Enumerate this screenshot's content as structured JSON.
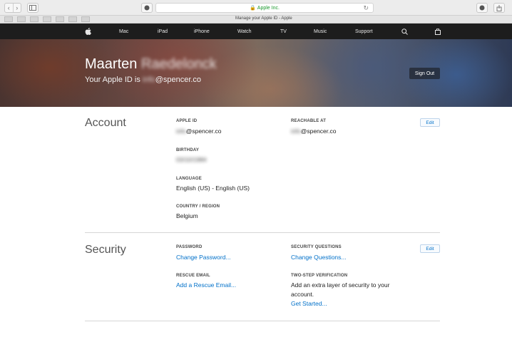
{
  "browser": {
    "url": "Apple Inc.",
    "tab_title": "Manage your Apple ID - Apple",
    "nav_back": "‹",
    "nav_forward": "›"
  },
  "global_nav": {
    "items": [
      "Mac",
      "iPad",
      "iPhone",
      "Watch",
      "TV",
      "Music",
      "Support"
    ]
  },
  "hero": {
    "first_name": "Maarten",
    "last_name": "Raedelonck",
    "apple_id_prefix": "Your Apple ID is",
    "apple_id_user": "info",
    "apple_id_domain": "@spencer.co",
    "sign_out": "Sign Out"
  },
  "account": {
    "title": "Account",
    "edit": "Edit",
    "apple_id_label": "APPLE ID",
    "apple_id_user": "info",
    "apple_id_domain": "@spencer.co",
    "reachable_label": "REACHABLE AT",
    "reachable_user": "info",
    "reachable_domain": "@spencer.co",
    "birthday_label": "BIRTHDAY",
    "birthday_value": "03/10/1984",
    "language_label": "LANGUAGE",
    "language_value": "English (US) - English (US)",
    "country_label": "COUNTRY / REGION",
    "country_value": "Belgium"
  },
  "security": {
    "title": "Security",
    "edit": "Edit",
    "password_label": "PASSWORD",
    "password_link": "Change Password...",
    "questions_label": "SECURITY QUESTIONS",
    "questions_link": "Change Questions...",
    "rescue_label": "RESCUE EMAIL",
    "rescue_link": "Add a Rescue Email...",
    "two_step_label": "TWO-STEP VERIFICATION",
    "two_step_text_1": "Add an extra layer of security to your",
    "two_step_text_2": "account.",
    "two_step_link": "Get Started..."
  }
}
